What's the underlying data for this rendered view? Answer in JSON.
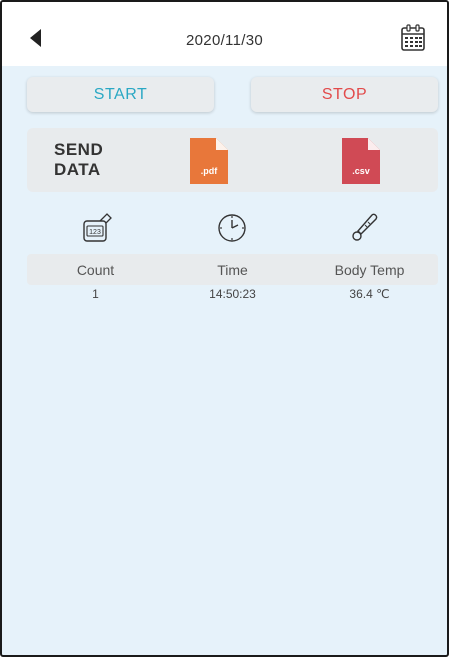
{
  "header": {
    "date": "2020/11/30",
    "back_icon": "back-arrow-icon",
    "calendar_icon": "calendar-icon"
  },
  "controls": {
    "start_label": "START",
    "stop_label": "STOP"
  },
  "send_data": {
    "line1": "SEND",
    "line2": "DATA",
    "pdf_label": ".pdf",
    "csv_label": ".csv"
  },
  "table": {
    "columns": [
      "Count",
      "Time",
      "Body Temp"
    ],
    "rows": [
      {
        "count": "1",
        "time": "14:50:23",
        "temp": "36.4 ℃"
      }
    ]
  },
  "colors": {
    "background": "#e6f2fa",
    "start": "#2aa8c4",
    "stop": "#e24a4a",
    "pdf": "#e8773a",
    "csv": "#d04a55"
  }
}
